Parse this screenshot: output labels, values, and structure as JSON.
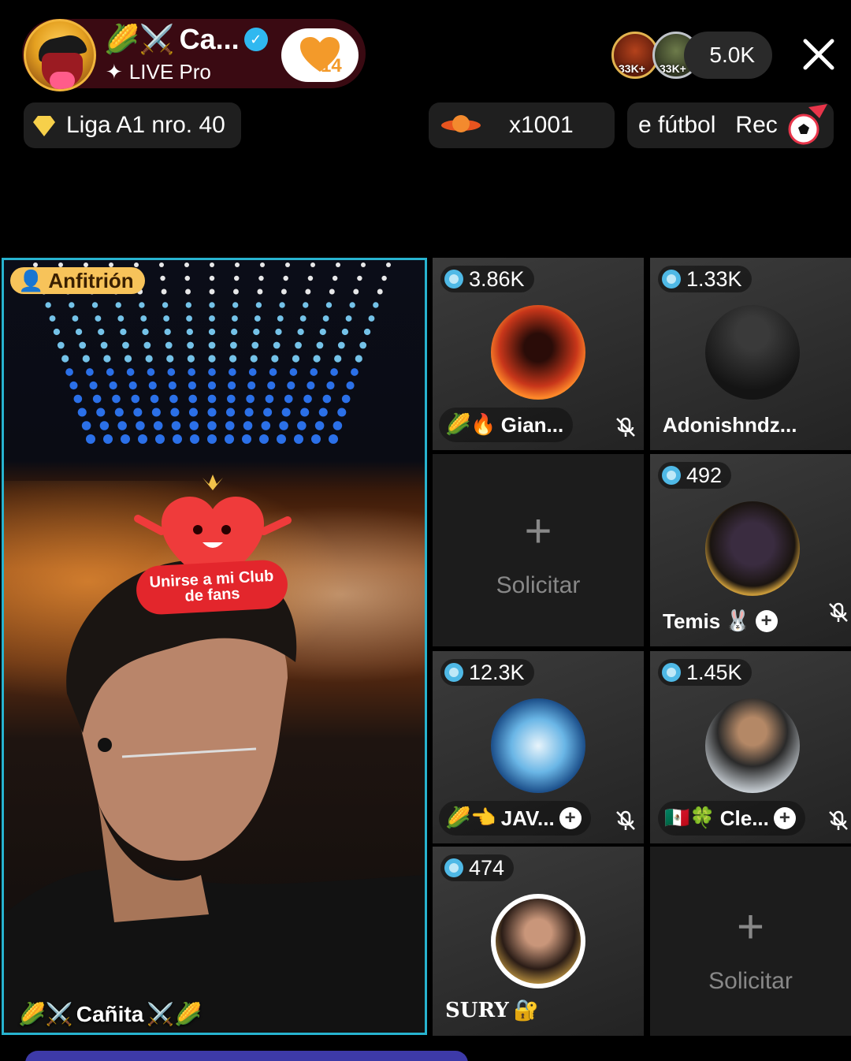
{
  "header": {
    "host_name": "Ca...",
    "host_emojis": "🌽⚔️",
    "host_subtitle": "LIVE Pro",
    "fan_level": "14",
    "viewer_badge_1": "33K+",
    "viewer_badge_2": "33K+",
    "viewer_count": "5.0K"
  },
  "chips": {
    "league": "Liga A1 nro. 40",
    "multiplier": "x1001",
    "soccer": "e fútbol   Rec"
  },
  "host_video": {
    "role_label": "Anfitrión",
    "fanclub_line1": "Unirse a mi Club",
    "fanclub_line2": "de fans",
    "nickname": "Cañita",
    "nickname_prefix": "🌽⚔️",
    "nickname_suffix": "⚔️🌽"
  },
  "guests": [
    {
      "score": "3.86K",
      "name": "Gian...",
      "prefix": "🌽🔥",
      "muted": true
    },
    {
      "score": "1.33K",
      "name": "Adonishndz...",
      "prefix": "",
      "muted": false
    },
    {
      "score": "492",
      "name": "Temis",
      "prefix": "",
      "suffix": "🐰",
      "muted": true
    },
    {
      "score": "12.3K",
      "name": "JAV...",
      "prefix": "🌽👈",
      "muted": true
    },
    {
      "score": "1.45K",
      "name": "Cle...",
      "prefix": "🇲🇽🍀",
      "muted": true
    },
    {
      "score": "474",
      "name": "SURY",
      "suffix": "🔐",
      "muted": false
    }
  ],
  "empty_slot_label": "Solicitar",
  "empty_slot_plus": "+",
  "colors": {
    "host_border": "#27b3cf",
    "host_label_bg": "#f7c35a",
    "verified": "#2fb8f0",
    "fanclub_red": "#e3262c"
  }
}
